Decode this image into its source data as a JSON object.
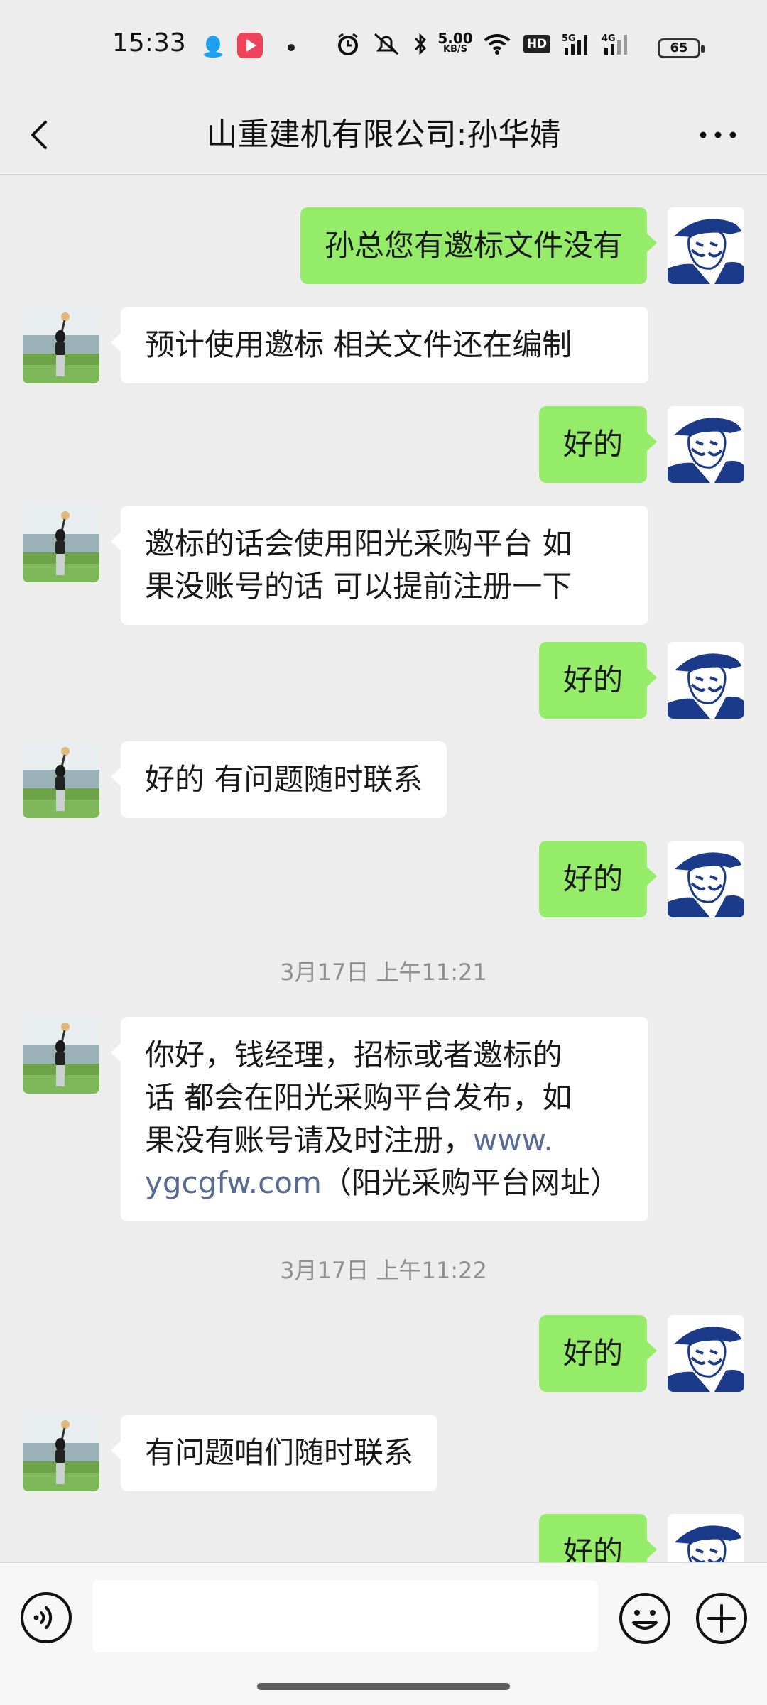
{
  "status_bar": {
    "time": "15:33",
    "net_speed_value": "5.00",
    "net_speed_unit": "KB/S",
    "hd_label": "HD",
    "signal_1": "5G",
    "signal_2": "4G",
    "battery": "65",
    "icons": [
      "qq-icon",
      "video-app-icon",
      "dot-icon",
      "alarm-icon",
      "mute-icon",
      "bluetooth-icon",
      "wifi-icon",
      "hd-icon",
      "signal-icon",
      "battery-icon"
    ]
  },
  "header": {
    "title": "山重建机有限公司:孙华婧"
  },
  "messages": [
    {
      "side": "right",
      "text": "孙总您有邀标文件没有"
    },
    {
      "side": "left",
      "text": "预计使用邀标  相关文件还在编制"
    },
    {
      "side": "right",
      "text": "好的"
    },
    {
      "side": "left",
      "line1": "邀标的话会使用阳光采购平台  如",
      "line2": "果没账号的话  可以提前注册一下"
    },
    {
      "side": "right",
      "text": "好的"
    },
    {
      "side": "left",
      "text": "好的  有问题随时联系"
    },
    {
      "side": "right",
      "text": "好的"
    },
    {
      "type": "time",
      "text": "3月17日 上午11:21"
    },
    {
      "side": "left",
      "line1": "你好，钱经理，招标或者邀标的",
      "line2": "话  都会在阳光采购平台发布，如",
      "line3_prefix": "果没有账号请及时注册，",
      "link_part1": "www.",
      "link_part2": "ygcgfw.com",
      "line4_suffix": "（阳光采购平台网址）"
    },
    {
      "type": "time",
      "text": "3月17日 上午11:22"
    },
    {
      "side": "right",
      "text": "好的"
    },
    {
      "side": "left",
      "text": "有问题咱们随时联系"
    },
    {
      "side": "right",
      "text": "好的"
    }
  ],
  "colors": {
    "background": "#ededed",
    "self_bubble": "#95ec69",
    "other_bubble": "#ffffff",
    "link": "#576b95"
  }
}
